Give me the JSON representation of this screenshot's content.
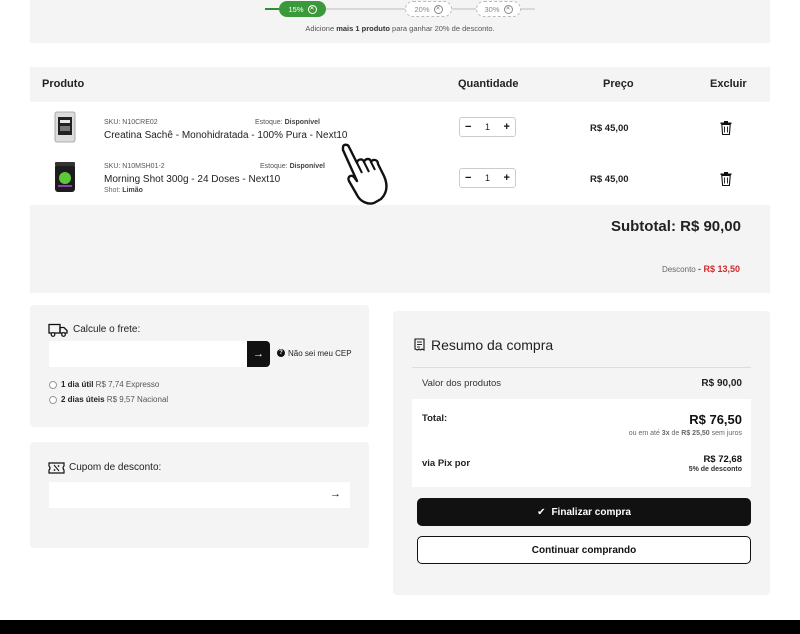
{
  "progress": {
    "steps": [
      "15%",
      "20%",
      "30%"
    ],
    "active_index": 0,
    "message_prefix": "Adicione ",
    "message_bold": "mais 1 produto",
    "message_suffix": " para ganhar 20% de desconto."
  },
  "cart": {
    "headers": {
      "product": "Produto",
      "quantity": "Quantidade",
      "price": "Preço",
      "remove": "Excluir"
    },
    "items": [
      {
        "sku": "SKU: N10CRE02",
        "stock_label": "Estoque: ",
        "stock_value": "Disponível",
        "name": "Creatina Sachê - Monohidratada - 100% Pura - Next10",
        "qty": "1",
        "price": "R$ 45,00"
      },
      {
        "sku": "SKU: N10MSH01-2",
        "stock_label": "Estoque: ",
        "stock_value": "Disponível",
        "name": "Morning Shot 300g - 24 Doses - Next10",
        "variant_label": "Shot: ",
        "variant_value": "Limão",
        "qty": "1",
        "price": "R$ 45,00"
      }
    ],
    "qty_minus": "−",
    "qty_plus": "+",
    "subtotal": "Subtotal: R$ 90,00",
    "discount_label": "Desconto ",
    "discount_value": "- R$ 13,50"
  },
  "shipping": {
    "title": "Calcule o frete:",
    "go_icon": "→",
    "help_icon": "?",
    "help_link": "Não sei meu CEP",
    "options": [
      {
        "bold": "1 dia útil",
        "price": " R$ 7,74",
        "service": " Expresso"
      },
      {
        "bold": "2 dias úteis",
        "price": " R$ 9,57",
        "service": " Nacional"
      }
    ]
  },
  "coupon": {
    "title": "Cupom de desconto:",
    "go_icon": "→"
  },
  "summary": {
    "title": "Resumo da compra",
    "products_label": "Valor dos produtos",
    "products_value": "R$ 90,00",
    "total_label": "Total:",
    "total_value": "R$ 76,50",
    "installments_prefix": "ou em até ",
    "installments_bold": "3x",
    "installments_mid": " de ",
    "installments_value": "R$ 25,50",
    "installments_suffix": " sem juros",
    "pix_label": "via Pix por",
    "pix_value": "R$ 72,68",
    "pix_discount": "5% de desconto",
    "checkout_icon": "✔",
    "checkout_button": "Finalizar compra",
    "continue_button": "Continuar comprando"
  },
  "colors": {
    "accent_green": "#3a9a3a",
    "discount_red": "#d32a2a",
    "primary_button": "#111111"
  }
}
